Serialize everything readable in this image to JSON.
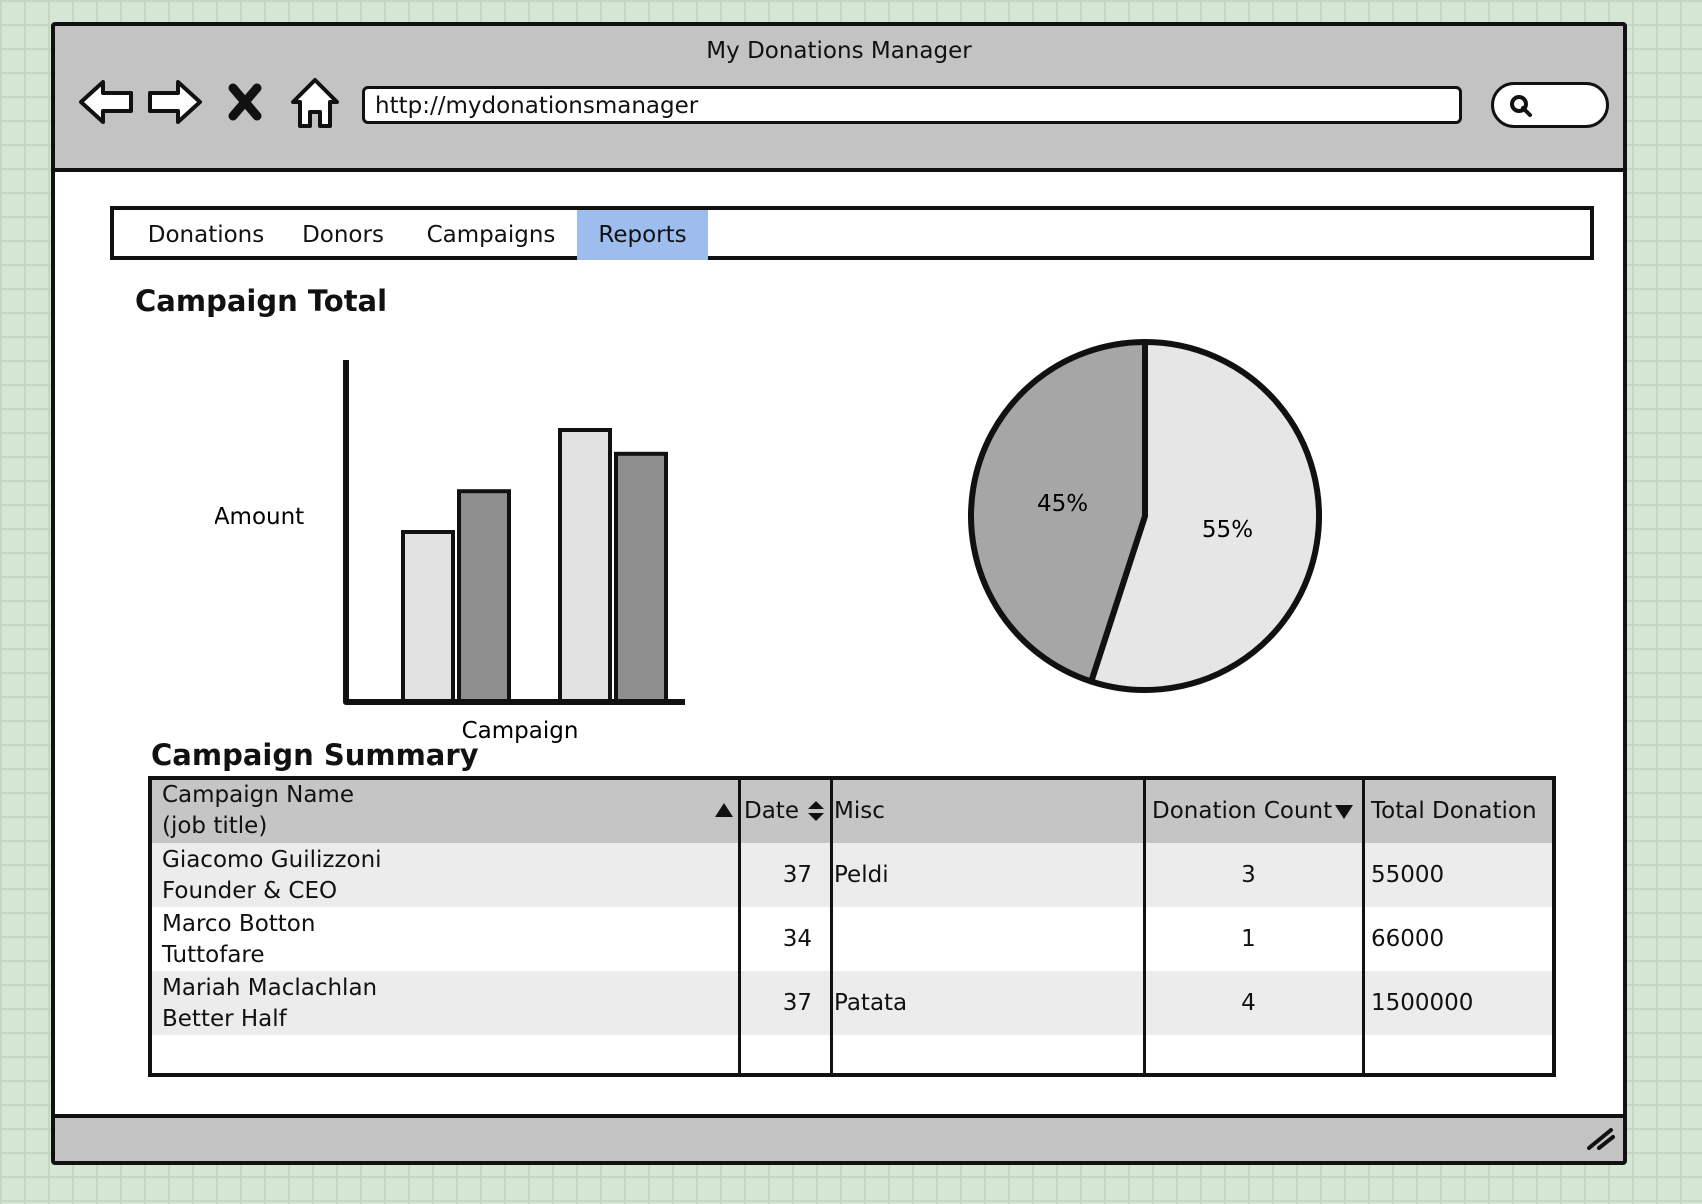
{
  "browser": {
    "title": "My Donations Manager",
    "url": "http://mydonationsmanager",
    "icons": [
      "back-arrow-icon",
      "forward-arrow-icon",
      "stop-icon",
      "home-icon",
      "search-icon",
      "resize-grip-icon"
    ]
  },
  "tabs": [
    {
      "label": "Donations",
      "active": false
    },
    {
      "label": "Donors",
      "active": false
    },
    {
      "label": "Campaigns",
      "active": false
    },
    {
      "label": "Reports",
      "active": true
    }
  ],
  "section_titles": {
    "campaign_total": "Campaign Total",
    "campaign_summary": "Campaign Summary"
  },
  "chart_data": [
    {
      "type": "bar",
      "title": "Campaign Total",
      "xlabel": "Campaign",
      "ylabel": "Amount",
      "categories": [
        "",
        ""
      ],
      "series": [
        {
          "values": [
            50,
            80
          ],
          "color": "#e2e2e2"
        },
        {
          "values": [
            62,
            73
          ],
          "color": "#8f8f8f"
        }
      ],
      "ylim": [
        0,
        100
      ],
      "grid": false
    },
    {
      "type": "pie",
      "labels": [
        "55%",
        "45%"
      ],
      "values": [
        55,
        45
      ],
      "colors": [
        "#e6e6e6",
        "#a6a6a6"
      ]
    }
  ],
  "table": {
    "headers": {
      "name": "Campaign Name",
      "name_sub": "(job title)",
      "date": "Date",
      "misc": "Misc",
      "count": "Donation Count",
      "total": "Total Donation"
    },
    "rows": [
      {
        "name": "Giacomo Guilizzoni",
        "title": "Founder & CEO",
        "date": "37",
        "misc": "Peldi",
        "count": "3",
        "total": "55000"
      },
      {
        "name": "Marco Botton",
        "title": "Tuttofare",
        "date": "34",
        "misc": "",
        "count": "1",
        "total": "66000"
      },
      {
        "name": "Mariah Maclachlan",
        "title": "Better Half",
        "date": "37",
        "misc": "Patata",
        "count": "4",
        "total": "1500000"
      }
    ]
  }
}
